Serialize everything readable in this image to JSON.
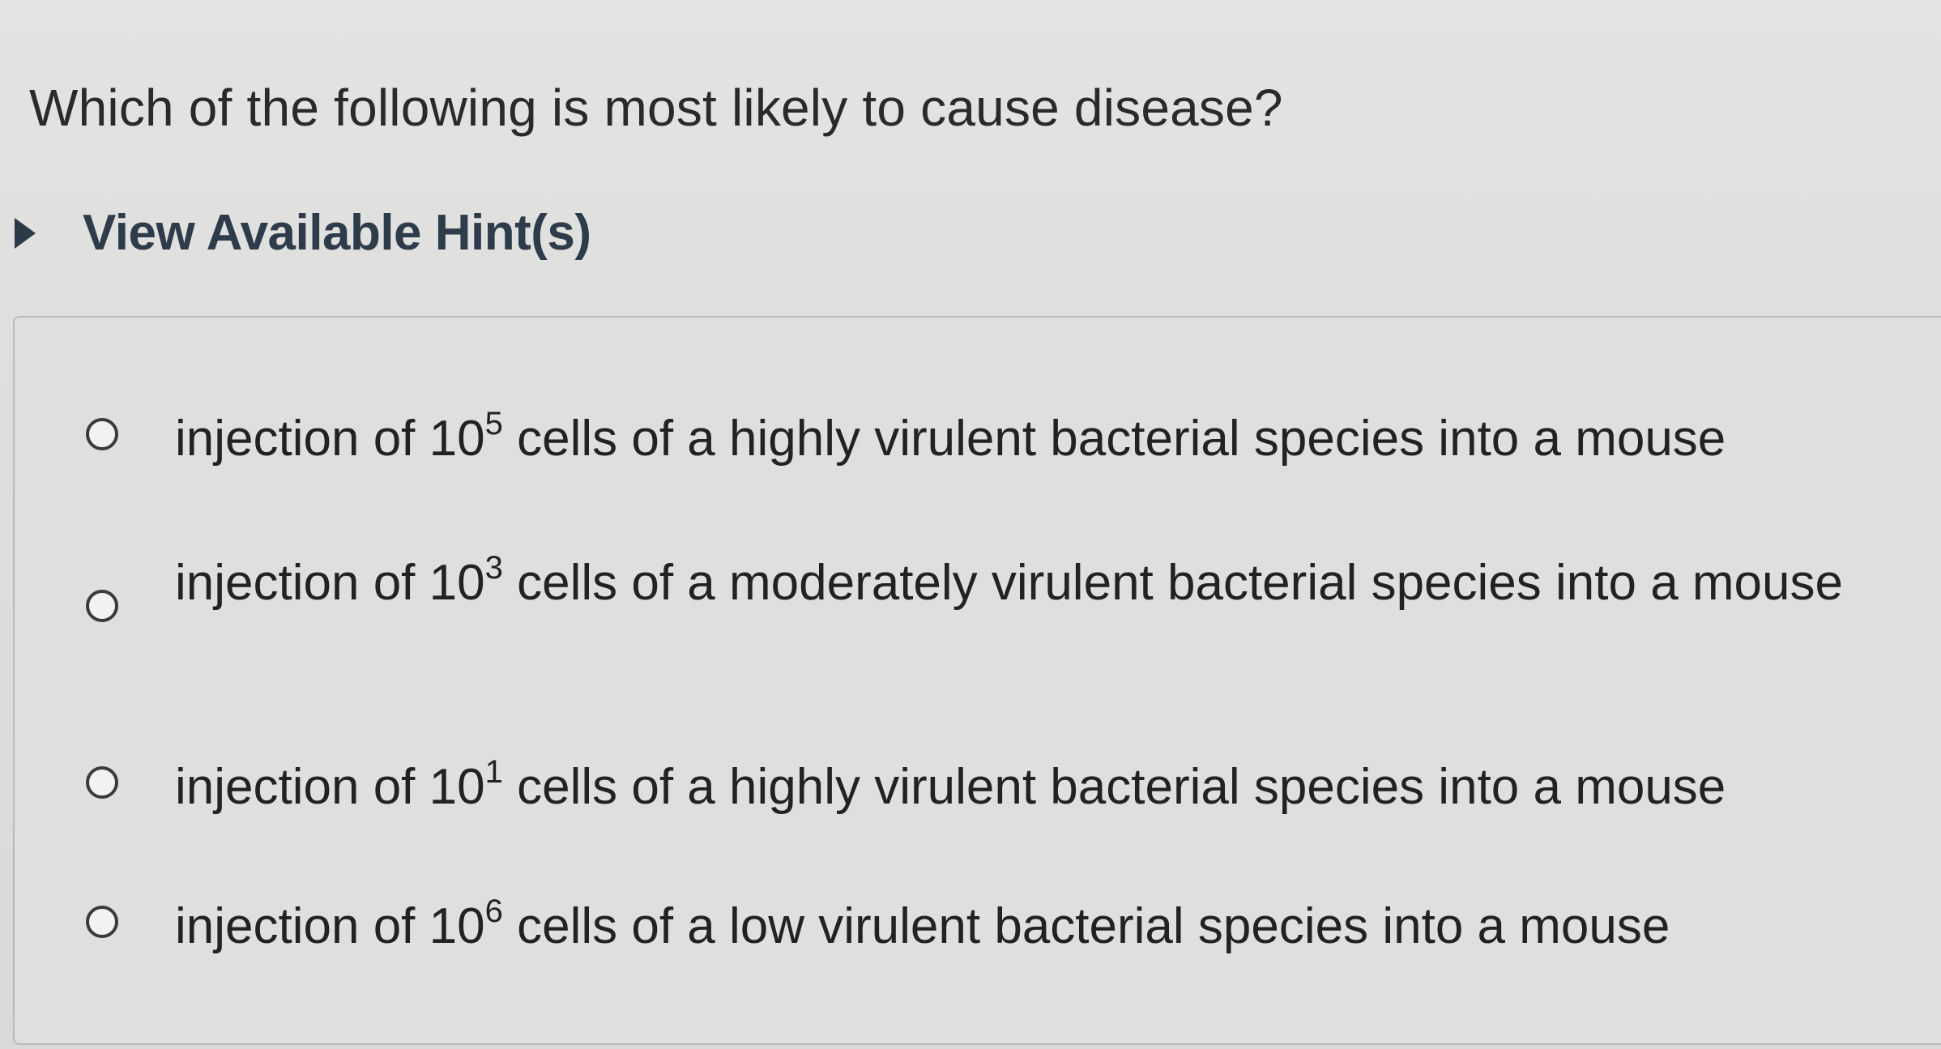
{
  "question": {
    "text": "Which of the following is most likely to cause disease?"
  },
  "hint": {
    "label": "View Available Hint(s)"
  },
  "options": [
    {
      "prefix": "injection of 10",
      "exponent": "5",
      "suffix": " cells of a highly virulent bacterial species into a mouse"
    },
    {
      "prefix": "injection of 10",
      "exponent": "3",
      "suffix": " cells of a moderately virulent bacterial species into a mouse"
    },
    {
      "prefix": "injection of 10",
      "exponent": "1",
      "suffix": " cells of a highly virulent bacterial species into a mouse"
    },
    {
      "prefix": "injection of 10",
      "exponent": "6",
      "suffix": " cells of a low virulent bacterial species into a mouse"
    }
  ],
  "icons": {
    "hint_toggle": "caret-right-icon",
    "option_control": "radio-button-icon"
  }
}
